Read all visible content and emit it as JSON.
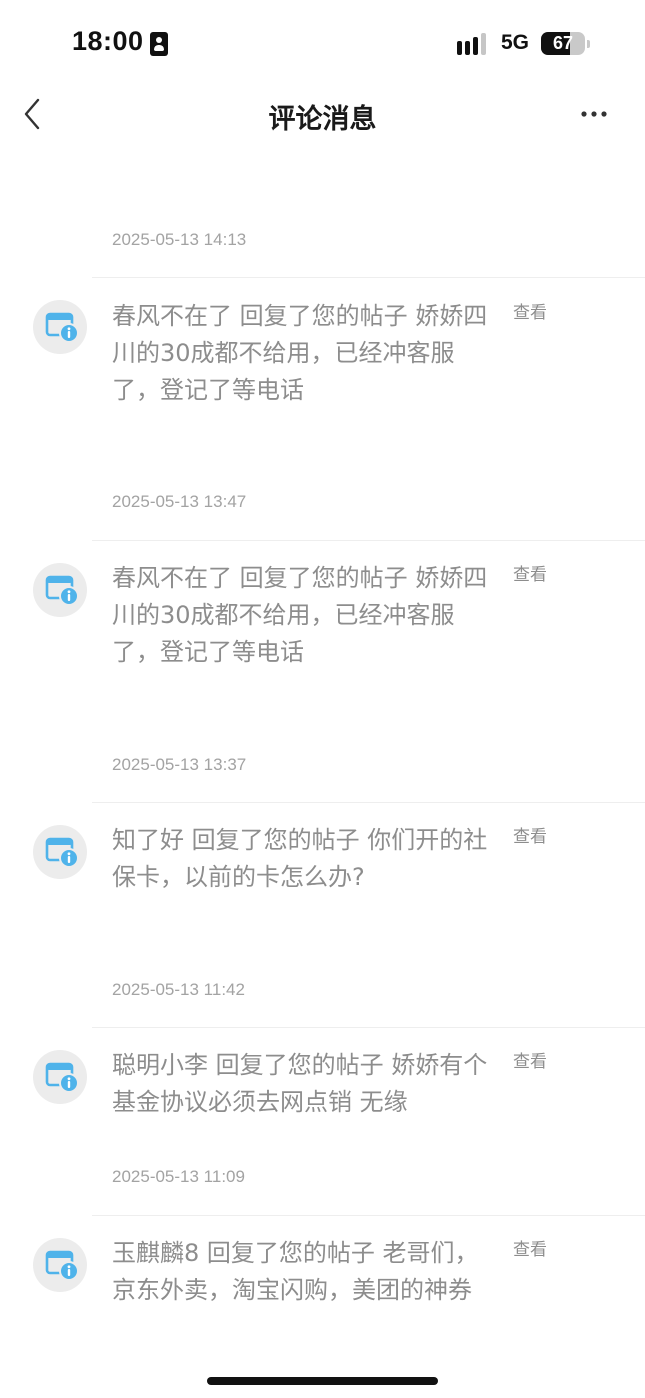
{
  "status_bar": {
    "time": "18:00",
    "network": "5G",
    "battery_level": "67"
  },
  "nav": {
    "title": "评论消息"
  },
  "messages": [
    {
      "time": "2025-05-13 14:13",
      "text": "春风不在了 回复了您的帖子 娇娇四川的30成都不给用，已经冲客服了，登记了等电话",
      "view_label": "查看"
    },
    {
      "time": "2025-05-13 13:47",
      "text": "春风不在了 回复了您的帖子 娇娇四川的30成都不给用，已经冲客服了，登记了等电话",
      "view_label": "查看"
    },
    {
      "time": "2025-05-13 13:37",
      "text": "知了好 回复了您的帖子 你们开的社保卡，以前的卡怎么办?",
      "view_label": "查看"
    },
    {
      "time": "2025-05-13 11:42",
      "text": "聪明小李 回复了您的帖子 娇娇有个基金协议必须去网点销 无缘",
      "view_label": "查看"
    },
    {
      "time": "2025-05-13 11:09",
      "text": "玉麒麟8 回复了您的帖子 老哥们，京东外卖，淘宝闪购，美团的神券",
      "view_label": "查看"
    }
  ],
  "colors": {
    "icon_blue": "#4fb3ea",
    "avatar_bg": "#ececec",
    "text_gray": "#8d8d8d"
  }
}
